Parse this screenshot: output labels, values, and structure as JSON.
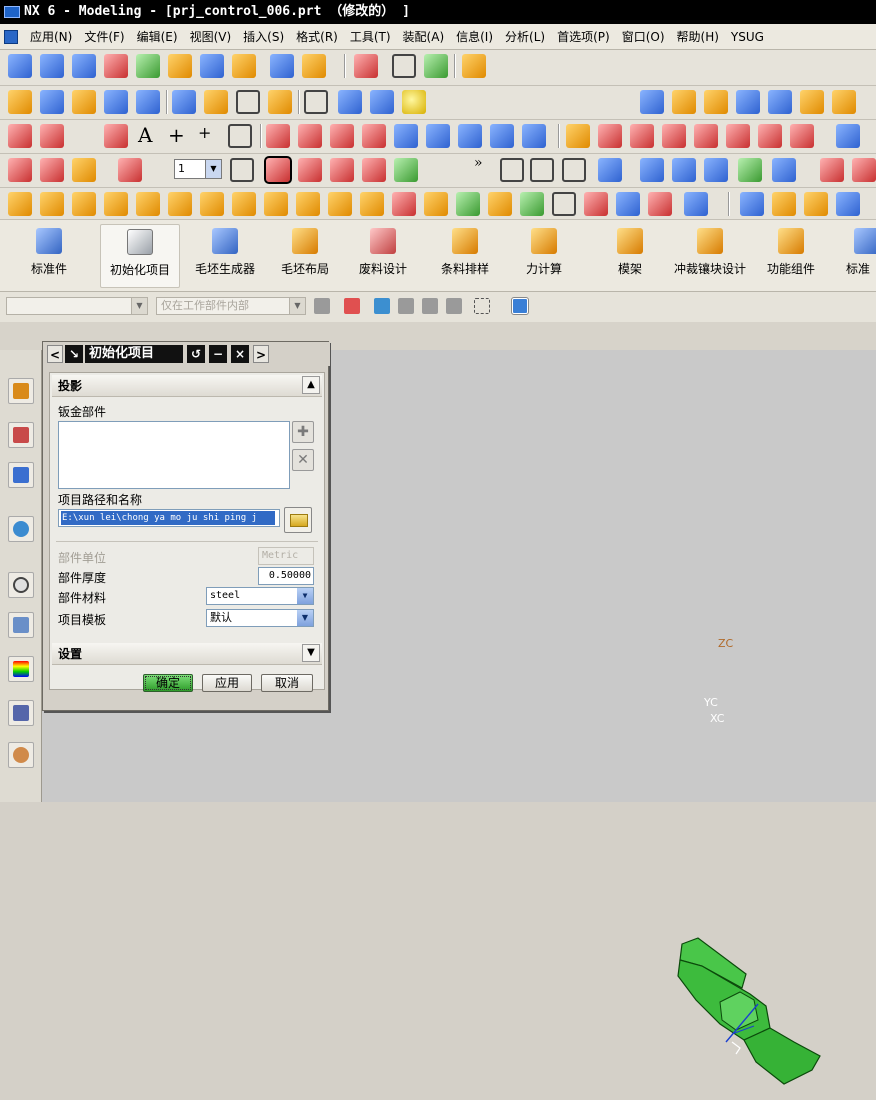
{
  "window": {
    "title": "NX 6 - Modeling - [prj_control_006.prt （修改的） ]"
  },
  "menu": [
    "应用(N)",
    "文件(F)",
    "编辑(E)",
    "视图(V)",
    "插入(S)",
    "格式(R)",
    "工具(T)",
    "装配(A)",
    "信息(I)",
    "分析(L)",
    "首选项(P)",
    "窗口(O)",
    "帮助(H)",
    "YSUG"
  ],
  "toolbar": {
    "text_tool": "A",
    "number_box": "1",
    "more": "»"
  },
  "ribbon": {
    "items": [
      "标准件",
      "初始化项目",
      "毛坯生成器",
      "毛坯布局",
      "废料设计",
      "条料排样",
      "力计算",
      "模架",
      "冲裁镶块设计",
      "功能组件",
      "标准"
    ]
  },
  "filter": {
    "scope": "仅在工作部件内部"
  },
  "dialog": {
    "title": "初始化项目",
    "section_projection": "投影",
    "label_sheet_part": "钣金部件",
    "label_path": "项目路径和名称",
    "path_value": "E:\\xun lei\\chong ya mo ju shi ping j",
    "label_unit": "部件单位",
    "unit_value": "Metric",
    "label_thickness": "部件厚度",
    "thickness_value": "0.50000",
    "label_material": "部件材料",
    "material_value": "steel",
    "label_template": "项目模板",
    "template_value": "默认",
    "section_settings": "设置",
    "btn_ok": "确定",
    "btn_apply": "应用",
    "btn_cancel": "取消"
  },
  "viewport": {
    "axis_z": "ZC",
    "axis_y": "YC",
    "axis_x": "XC"
  },
  "colors": {
    "model_green": "#3dbb3d",
    "viewport_bg": "#c9c9c9",
    "selection_blue": "#316ac5"
  }
}
